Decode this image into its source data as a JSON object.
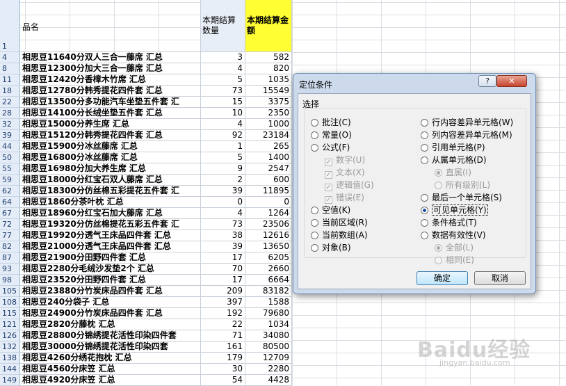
{
  "header": {
    "row_label": "1",
    "name": "品名",
    "qty": "本期结算数量",
    "amount": "本期结算金额"
  },
  "rows": [
    {
      "row": "4",
      "name": "相思豆11640分双人三合一藤席 汇总",
      "qty": "3",
      "amount": "582"
    },
    {
      "row": "8",
      "name": "相思豆12300分加大三合一藤席 汇总",
      "qty": "4",
      "amount": "820"
    },
    {
      "row": "11",
      "name": "相思豆12420分香樟木竹席 汇总",
      "qty": "5",
      "amount": "1035"
    },
    {
      "row": "18",
      "name": "相思豆12780分韩秀提花四件套 汇总",
      "qty": "73",
      "amount": "15549"
    },
    {
      "row": "22",
      "name": "相思豆13500分多功能汽车坐垫五件套 汇",
      "qty": "15",
      "amount": "3375"
    },
    {
      "row": "28",
      "name": "相思豆14100分长绒坐垫五件套 汇总",
      "qty": "10",
      "amount": "2350"
    },
    {
      "row": "32",
      "name": "相思豆15000分养生席 汇总",
      "qty": "4",
      "amount": "1000"
    },
    {
      "row": "39",
      "name": "相思豆15120分韩秀提花四件套 汇总",
      "qty": "92",
      "amount": "23184"
    },
    {
      "row": "44",
      "name": "相思豆15900分冰丝藤席 汇总",
      "qty": "1",
      "amount": "265"
    },
    {
      "row": "50",
      "name": "相思豆16800分冰丝藤席 汇总",
      "qty": "5",
      "amount": "1400"
    },
    {
      "row": "55",
      "name": "相思豆16980分加大养生席 汇总",
      "qty": "9",
      "amount": "2547"
    },
    {
      "row": "59",
      "name": "相思豆18000分红宝石双人藤席 汇总",
      "qty": "2",
      "amount": "600"
    },
    {
      "row": "62",
      "name": "相思豆18300分仿丝棉五彩提花五件套 汇",
      "qty": "39",
      "amount": "11895"
    },
    {
      "row": "64",
      "name": "相思豆1860分茶叶枕 汇总",
      "qty": "0",
      "amount": "0"
    },
    {
      "row": "67",
      "name": "相思豆18960分红宝石加大藤席 汇总",
      "qty": "4",
      "amount": "1264"
    },
    {
      "row": "72",
      "name": "相思豆19320分仿丝棉提花五彩五件套 汇",
      "qty": "73",
      "amount": "23506"
    },
    {
      "row": "77",
      "name": "相思豆19920分透气王床品四件套 汇总",
      "qty": "38",
      "amount": "12616"
    },
    {
      "row": "82",
      "name": "相思豆21000分透气王床品四件套 汇总",
      "qty": "39",
      "amount": "13650"
    },
    {
      "row": "87",
      "name": "相思豆21900分田野四件套 汇总",
      "qty": "17",
      "amount": "6205"
    },
    {
      "row": "93",
      "name": "相思豆2280分毛绒沙发垫2个 汇总",
      "qty": "70",
      "amount": "2660"
    },
    {
      "row": "98",
      "name": "相思豆23520分田野四件套 汇总",
      "qty": "17",
      "amount": "6664"
    },
    {
      "row": "105",
      "name": "相思豆23880分竹炭床品四件套 汇总",
      "qty": "209",
      "amount": "83182"
    },
    {
      "row": "108",
      "name": "相思豆240分袋子 汇总",
      "qty": "397",
      "amount": "1588"
    },
    {
      "row": "115",
      "name": "相思豆24900分竹炭床品四件套 汇总",
      "qty": "192",
      "amount": "79680"
    },
    {
      "row": "121",
      "name": "相思豆2820分藤枕 汇总",
      "qty": "22",
      "amount": "1034"
    },
    {
      "row": "126",
      "name": "相思豆28800分锦绣提花活性印染四件套",
      "qty": "71",
      "amount": "34080"
    },
    {
      "row": "132",
      "name": "相思豆30000分锦绣提花活性印染四套",
      "qty": "161",
      "amount": "80500"
    },
    {
      "row": "138",
      "name": "相思豆4260分绣花抱枕 汇总",
      "qty": "179",
      "amount": "12709"
    },
    {
      "row": "144",
      "name": "相思豆4560分床笠 汇总",
      "qty": "30",
      "amount": "2280"
    },
    {
      "row": "149",
      "name": "相思豆4920分床笠 汇总",
      "qty": "54",
      "amount": "4428"
    }
  ],
  "dialog": {
    "title": "定位条件",
    "help": "?",
    "close": "✕",
    "group_label": "选择",
    "left_options": [
      {
        "label": "批注(C)",
        "kind": "radio",
        "checked": false,
        "disabled": false
      },
      {
        "label": "常量(O)",
        "kind": "radio",
        "checked": false,
        "disabled": false
      },
      {
        "label": "公式(F)",
        "kind": "radio",
        "checked": false,
        "disabled": false
      },
      {
        "label": "数字(U)",
        "kind": "check",
        "checked": true,
        "disabled": true
      },
      {
        "label": "文本(X)",
        "kind": "check",
        "checked": true,
        "disabled": true
      },
      {
        "label": "逻辑值(G)",
        "kind": "check",
        "checked": true,
        "disabled": true
      },
      {
        "label": "错误(E)",
        "kind": "check",
        "checked": true,
        "disabled": true
      },
      {
        "label": "空值(K)",
        "kind": "radio",
        "checked": false,
        "disabled": false
      },
      {
        "label": "当前区域(R)",
        "kind": "radio",
        "checked": false,
        "disabled": false
      },
      {
        "label": "当前数组(A)",
        "kind": "radio",
        "checked": false,
        "disabled": false
      },
      {
        "label": "对象(B)",
        "kind": "radio",
        "checked": false,
        "disabled": false
      }
    ],
    "right_options": [
      {
        "label": "行内容差异单元格(W)",
        "kind": "radio",
        "checked": false,
        "disabled": false
      },
      {
        "label": "列内容差异单元格(M)",
        "kind": "radio",
        "checked": false,
        "disabled": false
      },
      {
        "label": "引用单元格(P)",
        "kind": "radio",
        "checked": false,
        "disabled": false
      },
      {
        "label": "从属单元格(D)",
        "kind": "radio",
        "checked": false,
        "disabled": false
      },
      {
        "label": "直属(I)",
        "kind": "radio",
        "checked": true,
        "disabled": true
      },
      {
        "label": "所有级别(L)",
        "kind": "radio",
        "checked": false,
        "disabled": true
      },
      {
        "label": "最后一个单元格(S)",
        "kind": "radio",
        "checked": false,
        "disabled": false
      },
      {
        "label": "可见单元格(Y)",
        "kind": "radio",
        "checked": true,
        "disabled": false
      },
      {
        "label": "条件格式(T)",
        "kind": "radio",
        "checked": false,
        "disabled": false
      },
      {
        "label": "数据有效性(V)",
        "kind": "radio",
        "checked": false,
        "disabled": false
      },
      {
        "label": "全部(L)",
        "kind": "radio",
        "checked": true,
        "disabled": true
      },
      {
        "label": "相同(E)",
        "kind": "radio",
        "checked": false,
        "disabled": true
      }
    ],
    "ok": "确定",
    "cancel": "取消"
  },
  "watermark": {
    "main": "Baidu经验",
    "sub": "jingyan.baidu.com"
  },
  "colors": {
    "amount_header": "#ffff33",
    "row_header": "#e4ecf7",
    "dialog_frame": "#ccdaeb"
  }
}
